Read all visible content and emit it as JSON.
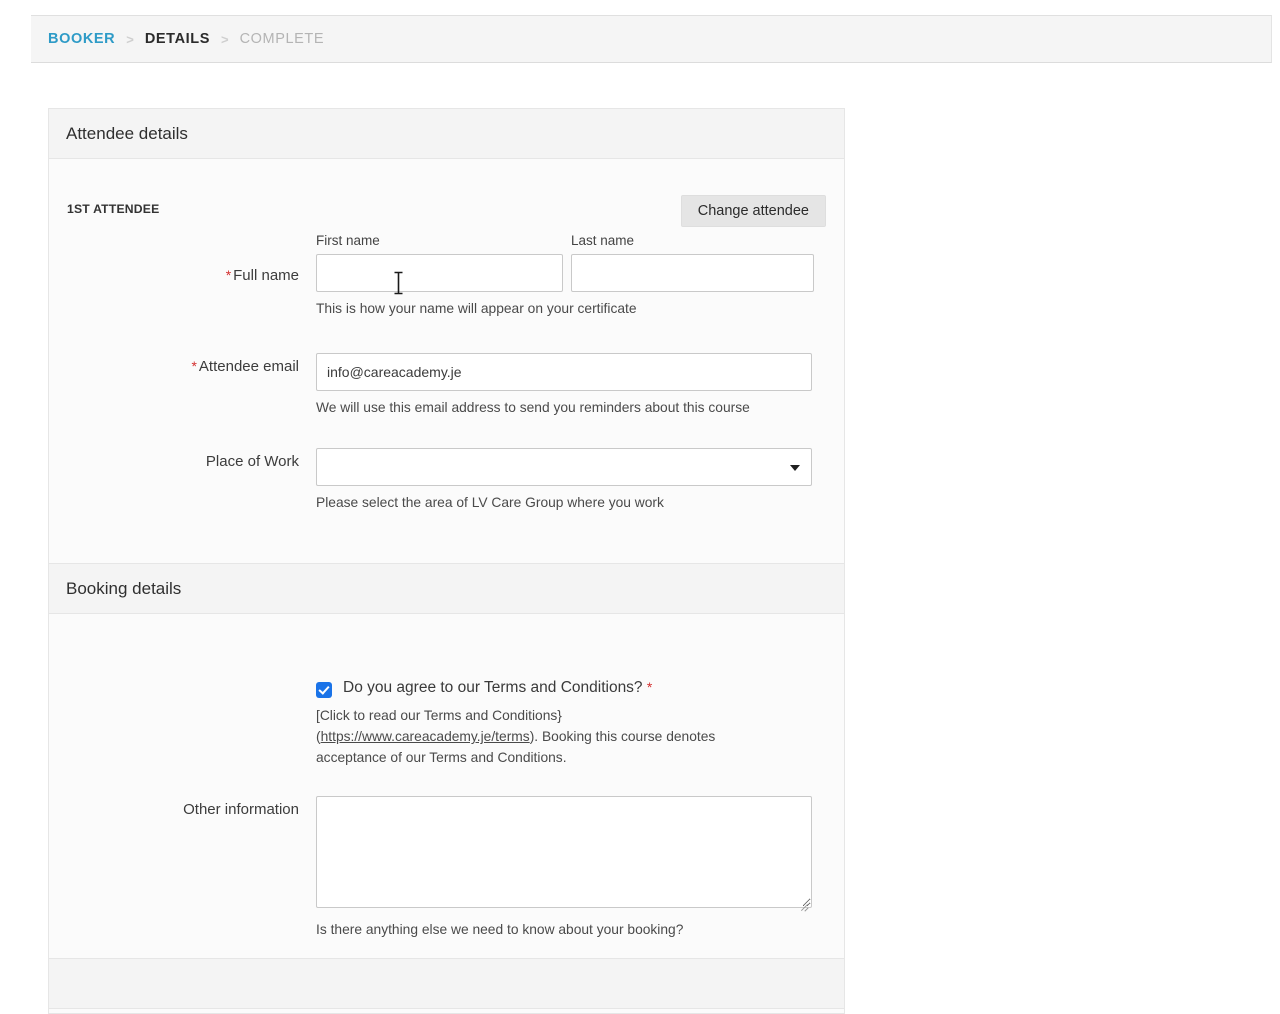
{
  "breadcrumb": {
    "separator": ">",
    "items": [
      {
        "label": "BOOKER",
        "state": "done"
      },
      {
        "label": "DETAILS",
        "state": "active"
      },
      {
        "label": "COMPLETE",
        "state": "future"
      }
    ]
  },
  "attendee_panel": {
    "title": "Attendee details",
    "attendee_index_label": "1ST ATTENDEE",
    "change_attendee_button": "Change attendee",
    "full_name": {
      "label": "Full name",
      "required_marker": "*",
      "first_name_label": "First name",
      "last_name_label": "Last name",
      "first_name_value": "",
      "last_name_value": "",
      "help": "This is how your name will appear on your certificate"
    },
    "email": {
      "label": "Attendee email",
      "required_marker": "*",
      "value": "info@careacademy.je",
      "help": "We will use this email address to send you reminders about this course"
    },
    "place_of_work": {
      "label": "Place of Work",
      "value": "",
      "help": "Please select the area of LV Care Group where you work"
    }
  },
  "booking_panel": {
    "title": "Booking details",
    "terms": {
      "checked": true,
      "label": "Do you agree to our Terms and Conditions?",
      "required_marker": "*",
      "help_prefix": "[Click to read our Terms and Conditions} (",
      "help_link": "https://www.careacademy.je/terms",
      "help_suffix": "). Booking this course denotes acceptance of our Terms and Conditions."
    },
    "other_information": {
      "label": "Other information",
      "value": "",
      "help": "Is there anything else we need to know about your booking?"
    }
  },
  "colors": {
    "breadcrumb_done": "#2e9bc7",
    "required_asterisk": "#d32f2f",
    "checkbox_checked": "#1a73e8",
    "panel_header_bg": "#f4f4f4"
  }
}
